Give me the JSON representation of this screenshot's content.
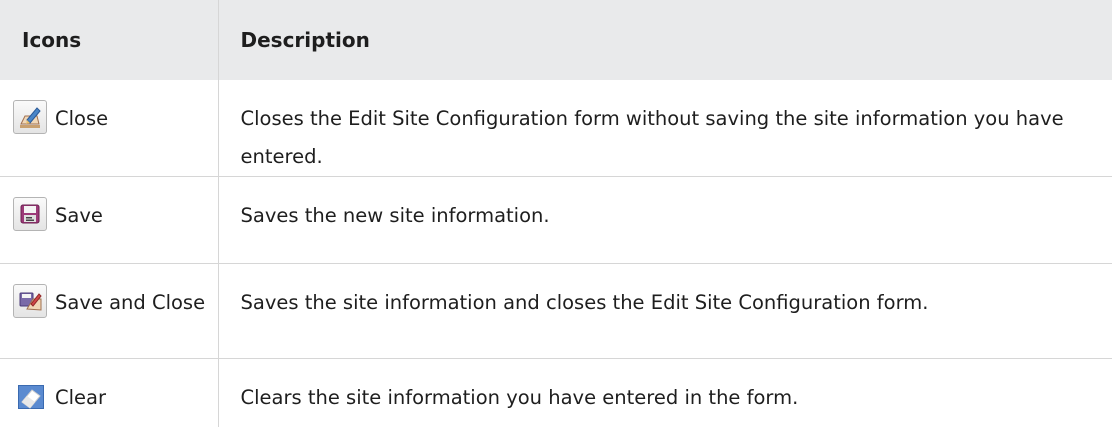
{
  "table": {
    "headers": {
      "icons": "Icons",
      "description": "Description"
    },
    "rows": [
      {
        "icon": "close-edit-icon",
        "label": "Close",
        "description": "Closes the Edit Site Configuration form without saving the site information you have entered."
      },
      {
        "icon": "save-disk-icon",
        "label": "Save",
        "description": "Saves the new site information."
      },
      {
        "icon": "save-and-close-icon",
        "label": "Save and Close",
        "description": "Saves the site information and closes the Edit Site Configuration form."
      },
      {
        "icon": "clear-eraser-icon",
        "label": "Clear",
        "description": "Clears the site information you have entered in the form."
      }
    ]
  }
}
